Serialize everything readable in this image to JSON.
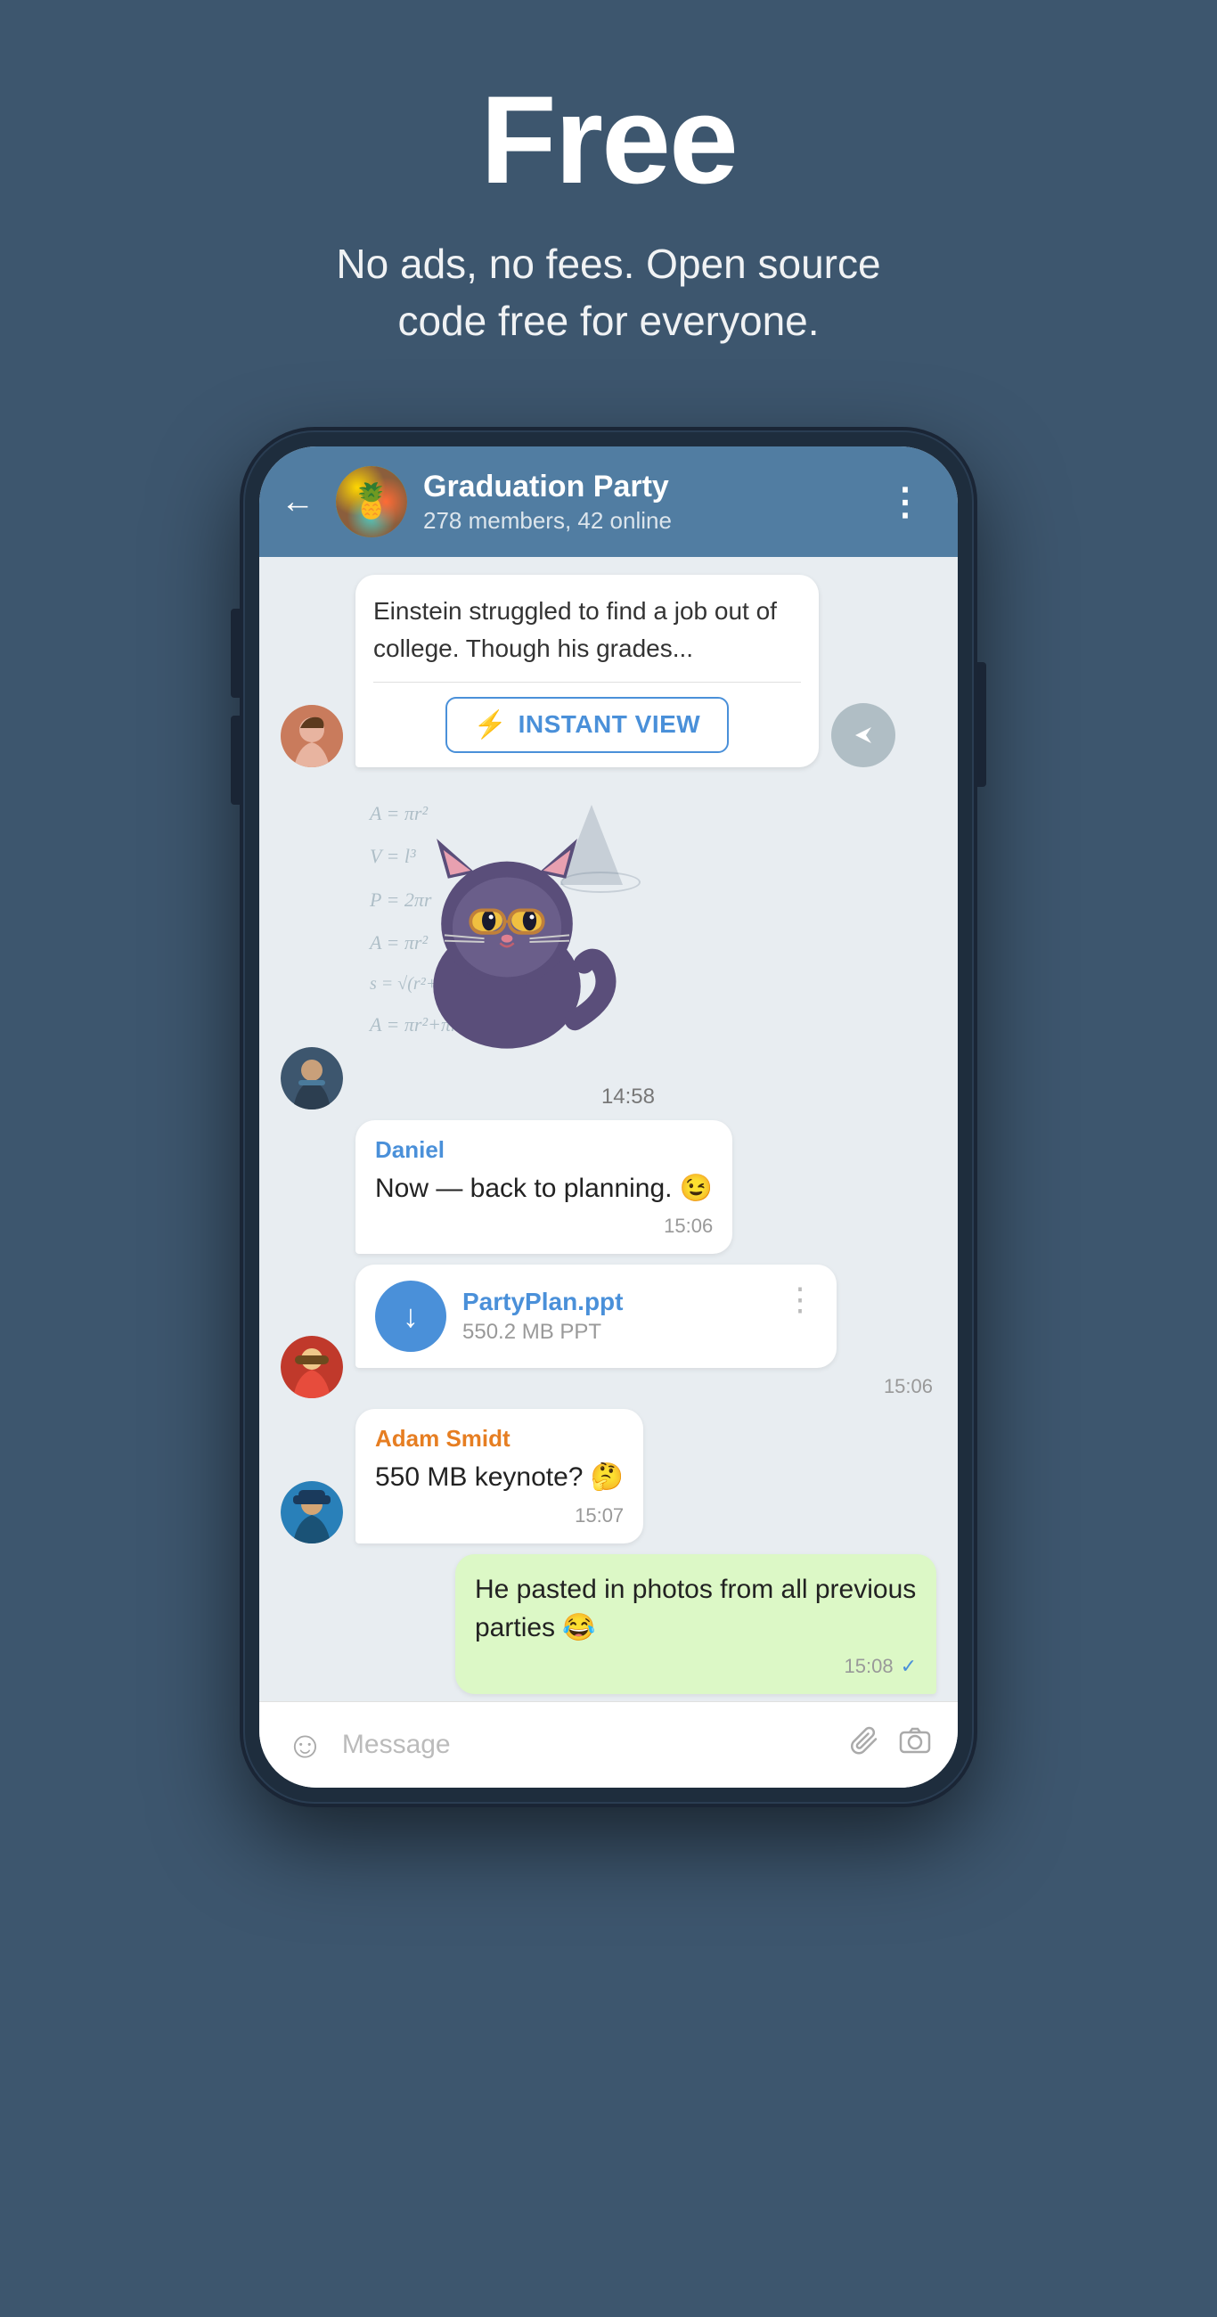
{
  "hero": {
    "title": "Free",
    "subtitle": "No ads, no fees. Open source\ncode free for everyone."
  },
  "chat": {
    "back_label": "←",
    "group_name": "Graduation Party",
    "group_meta": "278 members, 42 online",
    "menu_icon": "⋮",
    "group_emoji": "🍍"
  },
  "messages": [
    {
      "type": "instant_view",
      "text": "Einstein struggled to find a job out of college. Though his grades...",
      "button_label": "INSTANT VIEW"
    },
    {
      "type": "sticker",
      "time": "14:58"
    },
    {
      "type": "text",
      "sender": "Daniel",
      "sender_color": "daniel",
      "text": "Now — back to planning. 😉",
      "time": "15:06"
    },
    {
      "type": "file",
      "file_name": "PartyPlan.ppt",
      "file_size": "550.2 MB PPT",
      "time": "15:06"
    },
    {
      "type": "text",
      "sender": "Adam Smidt",
      "sender_color": "adam",
      "text": "550 MB keynote? 🤔",
      "time": "15:07"
    },
    {
      "type": "sent",
      "text": "He pasted in photos from all previous parties 😂",
      "time": "15:08",
      "check": "✓"
    }
  ],
  "input": {
    "placeholder": "Message",
    "emoji_icon": "☺",
    "attachment_icon": "📎",
    "camera_icon": "⊙"
  }
}
